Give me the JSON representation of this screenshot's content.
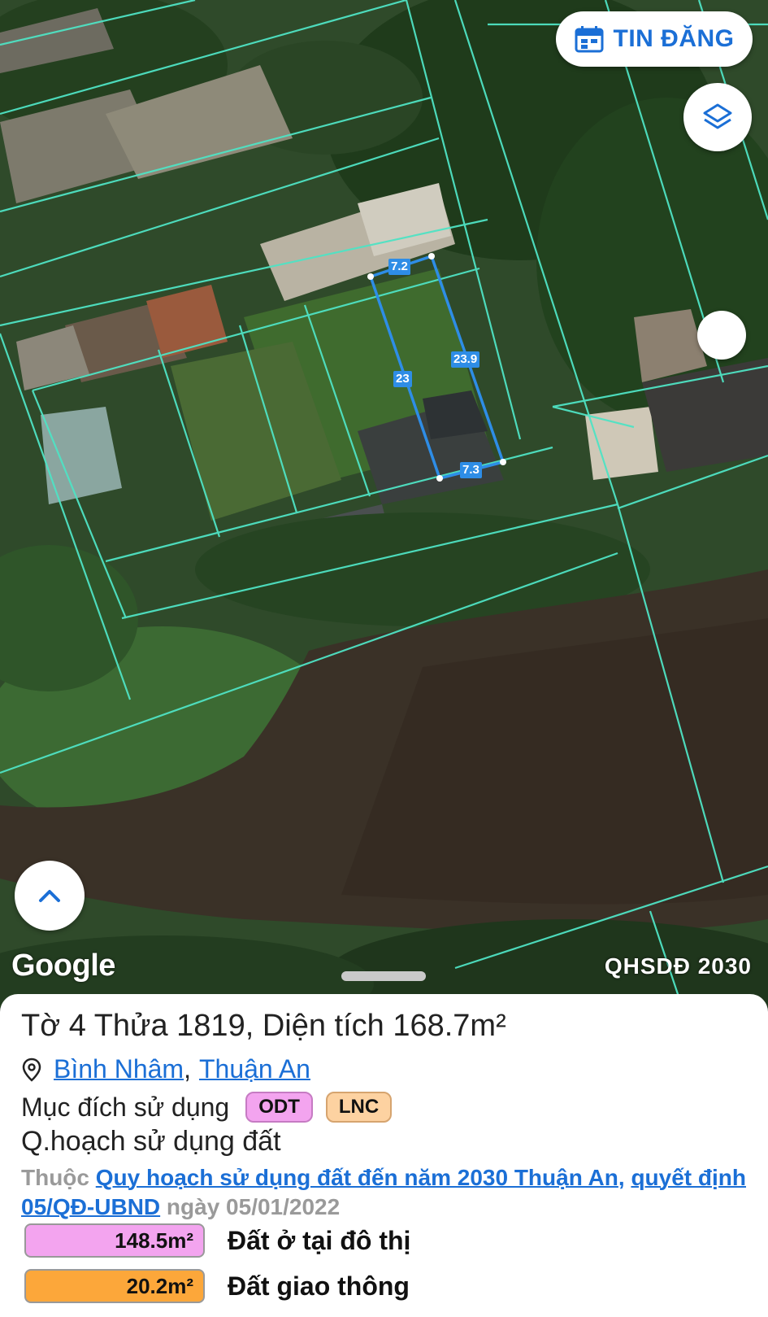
{
  "map": {
    "post_button_label": "TIN ĐĂNG",
    "google_label": "Google",
    "plan_layer_label": "QHSDĐ 2030",
    "icons": {
      "post": "calendar-icon",
      "layers": "layers-icon",
      "up": "chevron-up-icon",
      "pin": "location-pin-icon"
    },
    "parcel_dimensions": {
      "top": "7.2",
      "left": "23",
      "right": "23.9",
      "bottom": "7.3"
    },
    "colors": {
      "parcel_boundary": "#4fe3c4",
      "selected_parcel": "#2e8de6",
      "accent": "#1b6fd6"
    }
  },
  "parcel": {
    "title": "Tờ 4 Thửa 1819, Diện tích 168.7m²",
    "ward": "Bình Nhâm",
    "separator": ",",
    "district": "Thuận An",
    "purpose_label": "Mục đích sử dụng",
    "purpose_codes": [
      {
        "code": "ODT",
        "color": "#f3a4ef"
      },
      {
        "code": "LNC",
        "color": "#fdd2a1"
      }
    ],
    "plan_heading": "Q.hoạch sử dụng đất",
    "plan_prefix": "Thuộc ",
    "plan_link": "Quy hoạch sử dụng đất đến năm 2030 Thuận An",
    "plan_comma": ", ",
    "decision_link": "quyết định 05/QĐ-UBND",
    "date_text": " ngày 05/01/2022",
    "areas": [
      {
        "value": "148.5m²",
        "name": "Đất ở tại đô thị",
        "color": "#f3a4ef"
      },
      {
        "value": "20.2m²",
        "name": "Đất giao thông",
        "color": "#fca73a"
      }
    ]
  }
}
